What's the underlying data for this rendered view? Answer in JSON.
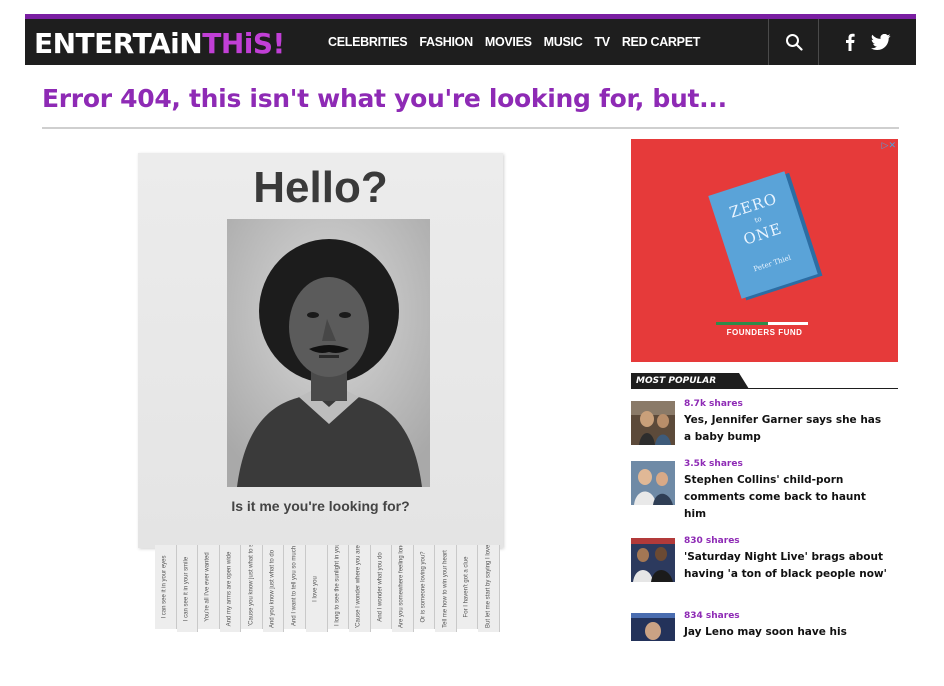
{
  "brand": {
    "logo_part1": "ENTERTAiN",
    "logo_part2": "THiS!",
    "accent_color": "#8e2ab5"
  },
  "nav": {
    "items": [
      "CELEBRITIES",
      "FASHION",
      "MOVIES",
      "MUSIC",
      "TV",
      "RED CARPET"
    ]
  },
  "header_icons": [
    "search-icon",
    "facebook-icon",
    "twitter-icon"
  ],
  "page": {
    "error_title": "Error 404, this isn't what you're looking for, but..."
  },
  "poster": {
    "heading": "Hello?",
    "caption": "Is it me you're looking for?",
    "tabs": [
      "I can see it in your eyes",
      "I can see it in your smile",
      "You're all I've ever wanted",
      "And my arms are open wide",
      "'Cause you know just what to say",
      "And you know just what to do",
      "And I want to tell you so much",
      "I love you",
      "I long to see the sunlight in your hair",
      "'Cause I wonder where you are",
      "And I wonder what you do",
      "Are you somewhere feeling lonely",
      "Or is someone loving you?",
      "Tell me how to win your heart",
      "For I haven't got a clue",
      "But let me start by saying I love you"
    ]
  },
  "ad": {
    "choice_label": "▷✕",
    "book_title_1": "ZERO",
    "book_title_2": "to",
    "book_title_3": "ONE",
    "book_author": "Peter Thiel",
    "footer_text": "FOUNDERS FUND",
    "background_color": "#e63a3a"
  },
  "most_popular": {
    "heading": "MOST POPULAR",
    "items": [
      {
        "shares": "8.7k shares",
        "title": "Yes, Jennifer Garner says she has a baby bump"
      },
      {
        "shares": "3.5k shares",
        "title": "Stephen Collins' child-porn comments come back to haunt him"
      },
      {
        "shares": "830 shares",
        "title": "'Saturday Night Live' brags about having 'a ton of black people now'"
      },
      {
        "shares": "834 shares",
        "title": "Jay Leno may soon have his"
      }
    ]
  }
}
